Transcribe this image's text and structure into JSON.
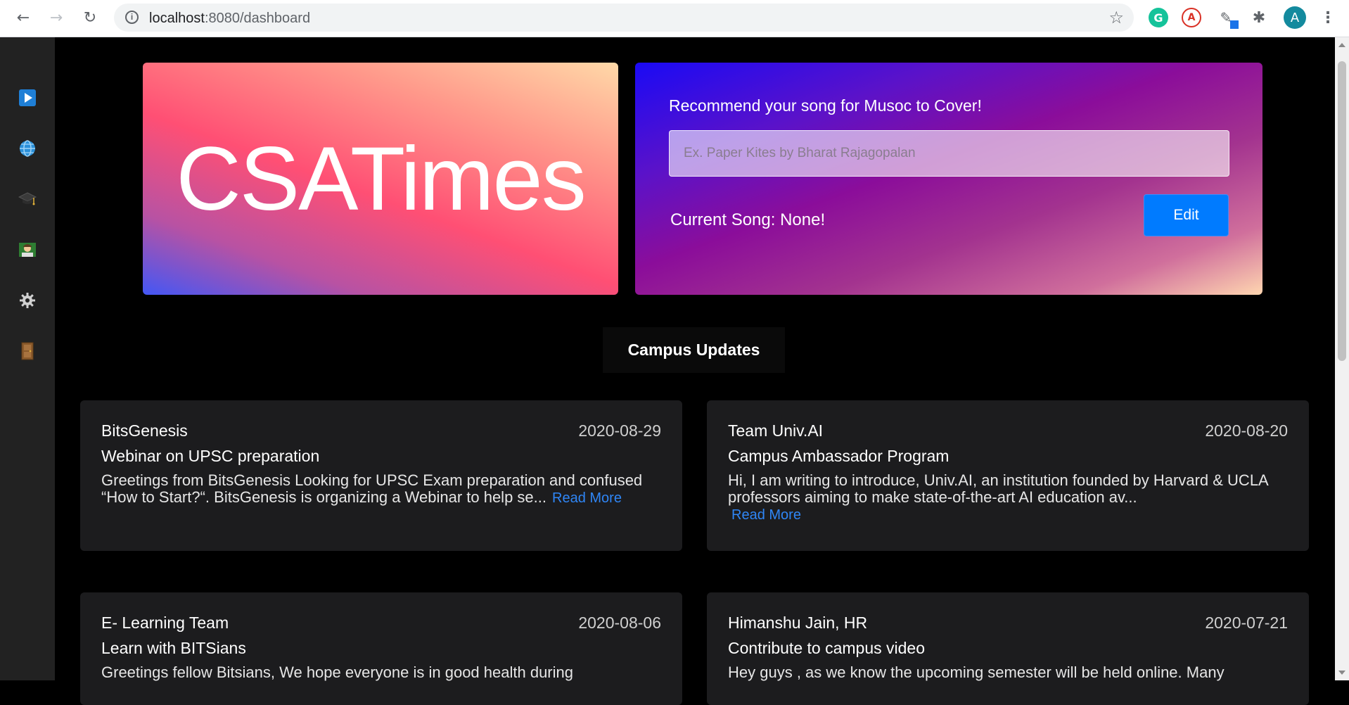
{
  "browser": {
    "url_host": "localhost",
    "url_path": ":8080/dashboard",
    "avatar_letter": "A",
    "grammarly_letter": "G"
  },
  "sidebar": {
    "items": [
      {
        "icon": "play-icon"
      },
      {
        "icon": "globe-icon"
      },
      {
        "icon": "graduation-cap-icon"
      },
      {
        "icon": "student-icon"
      },
      {
        "icon": "gear-icon"
      },
      {
        "icon": "door-icon"
      }
    ]
  },
  "hero": {
    "logo_text": "CSATimes"
  },
  "song": {
    "prompt": "Recommend your song for Musoc to Cover!",
    "placeholder": "Ex. Paper Kites by Bharat Rajagopalan",
    "current": "Current Song: None!",
    "edit_label": "Edit"
  },
  "updates": {
    "title": "Campus Updates",
    "read_more": "Read More",
    "cards": [
      {
        "author": "BitsGenesis",
        "date": "2020-08-29",
        "headline": "Webinar on UPSC preparation",
        "excerpt": "Greetings from BitsGenesis Looking for UPSC Exam preparation and confused “How to Start?“. BitsGenesis is organizing a  Webinar to help se..."
      },
      {
        "author": "Team Univ.AI",
        "date": "2020-08-20",
        "headline": "Campus Ambassador Program",
        "excerpt": "Hi, I am writing to introduce, Univ.AI, an institution founded by Harvard & UCLA professors aiming to make state-of-the-art AI education av..."
      },
      {
        "author": "E- Learning Team",
        "date": "2020-08-06",
        "headline": "Learn with BITSians",
        "excerpt": "Greetings fellow Bitsians, We hope everyone is in good health during"
      },
      {
        "author": "Himanshu Jain, HR",
        "date": "2020-07-21",
        "headline": "Contribute to campus video",
        "excerpt": "Hey guys , as we know the upcoming semester will be held online. Many"
      }
    ]
  }
}
